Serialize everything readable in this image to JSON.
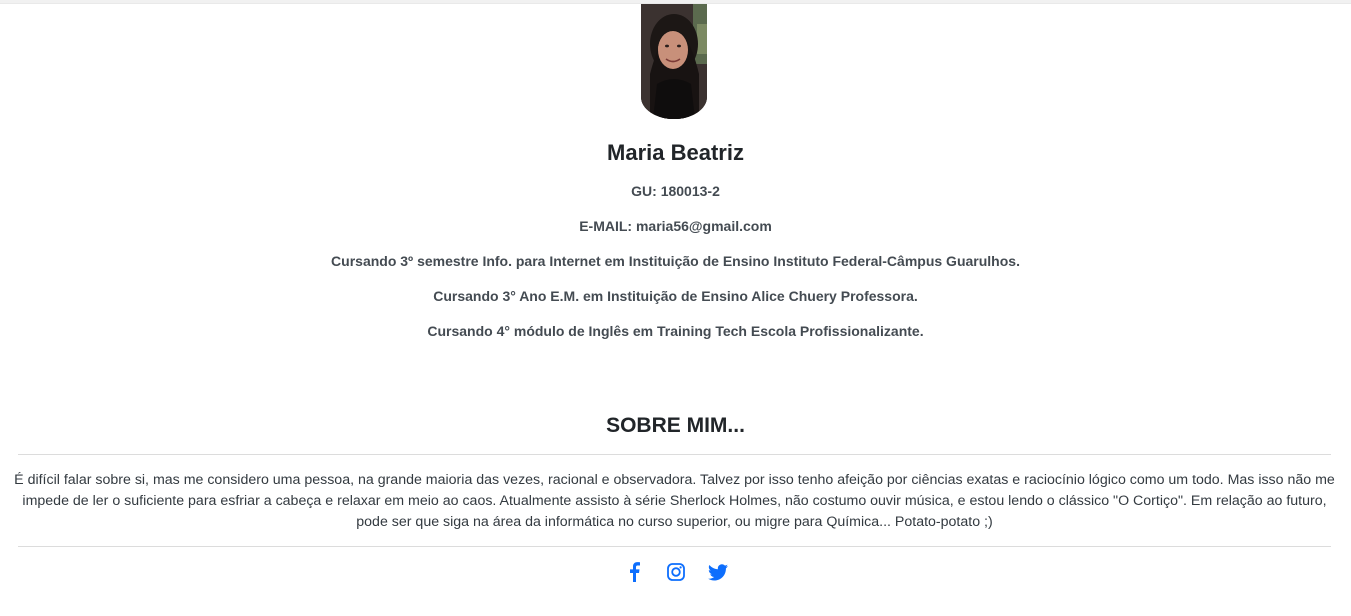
{
  "profile": {
    "name": "Maria Beatriz",
    "gu": "GU: 180013-2",
    "email": "E-MAIL: maria56@gmail.com",
    "course_1": "Cursando 3º semestre Info. para Internet em Instituição de Ensino Instituto Federal-Câmpus Guarulhos.",
    "course_2": "Cursando 3° Ano E.M. em Instituição de Ensino Alice Chuery Professora.",
    "course_3": "Cursando 4° módulo de Inglês em Training Tech Escola Profissionalizante."
  },
  "about": {
    "title": "SOBRE MIM...",
    "text": "É difícil falar sobre si, mas me considero uma pessoa, na grande maioria das vezes, racional e observadora. Talvez por isso tenho afeição por ciências exatas e raciocínio lógico como um todo. Mas isso não me impede de ler o suficiente para esfriar a cabeça e relaxar em meio ao caos. Atualmente assisto à série Sherlock Holmes, não costumo ouvir música, e estou lendo o clássico \"O Cortiço\". Em relação ao futuro, pode ser que siga na área da informática no curso superior, ou migre para Química... Potato-potato ;)"
  },
  "social": {
    "accent_color": "#0d6efd",
    "icons": [
      "facebook-icon",
      "instagram-icon",
      "twitter-icon"
    ]
  }
}
